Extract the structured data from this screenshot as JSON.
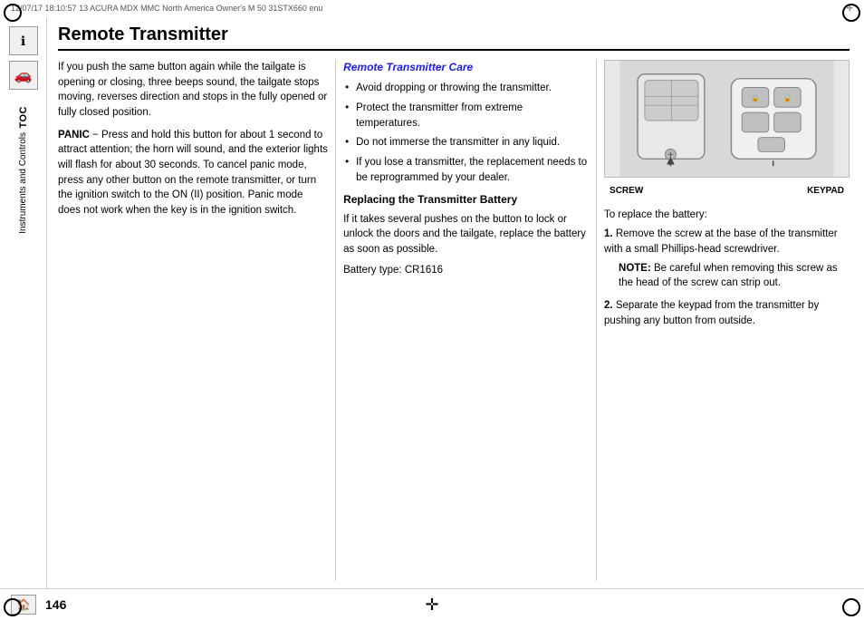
{
  "topBar": {
    "left": "12/07/17  18:10:57   13 ACURA MDX MMC North America Owner's M 50 31STX660 enu",
    "center": ""
  },
  "pageTitle": "Remote Transmitter",
  "leftColumn": {
    "paragraph1": "If you push the same button again while the tailgate is opening or closing, three beeps sound, the tailgate stops moving, reverses direction and stops in the fully opened or fully closed position.",
    "panicLabel": "PANIC",
    "panicDash": " −",
    "panicText": " Press and hold this button for about 1 second to attract attention; the horn will sound, and the exterior lights will flash for about 30 seconds. To cancel panic mode, press any other button on the remote transmitter, or turn the ignition switch to the ON (II) position. Panic mode does not work when the key is in the ignition switch."
  },
  "middleColumn": {
    "careTitle": "Remote Transmitter Care",
    "bullets": [
      "Avoid dropping or throwing the transmitter.",
      "Protect the transmitter from extreme temperatures.",
      "Do not immerse the transmitter in any liquid.",
      "If you lose a transmitter, the replacement needs to be reprogrammed by your dealer."
    ],
    "replacingTitle": "Replacing the Transmitter Battery",
    "replacingText": "If it takes several pushes on the button to lock or unlock the doors and the tailgate, replace the battery as soon as possible.",
    "batteryType": "Battery type: CR1616"
  },
  "rightColumn": {
    "imageAlt": "Remote transmitter diagram showing screw and keypad locations",
    "screwLabel": "SCREW",
    "keypadLabel": "KEYPAD",
    "introText": "To replace the battery:",
    "steps": [
      {
        "number": "1.",
        "text": "Remove the screw at the base of the transmitter with a small Phillips-head screwdriver.",
        "note": {
          "label": "NOTE:",
          "text": " Be careful when removing this screw as the head of the screw can strip out."
        }
      },
      {
        "number": "2.",
        "text": "Separate the keypad from the transmitter by pushing any button from outside.",
        "note": null
      }
    ]
  },
  "sidebar": {
    "tocLabel": "TOC",
    "instrumentsLabel": "Instruments and Controls"
  },
  "footer": {
    "pageNumber": "146",
    "homeLabel": "Home"
  }
}
